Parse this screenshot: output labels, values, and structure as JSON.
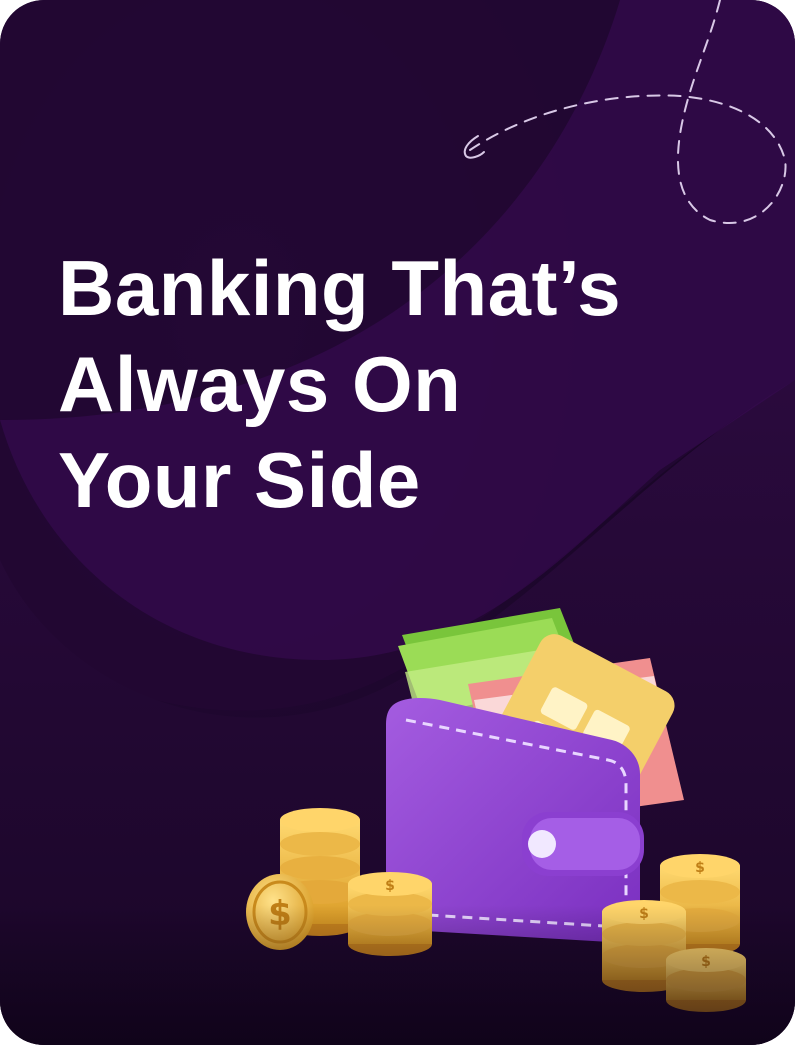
{
  "hero": {
    "headline_lines": [
      "Banking That’s",
      "Always On",
      "Your Side"
    ]
  },
  "colors": {
    "background_dark": "#14051f",
    "background_purple": "#3a0a55",
    "headline_text": "#ffffff",
    "wallet_purple": "#8b3fd0",
    "coin_gold": "#f2c14e",
    "bill_green": "#8fd14f",
    "card_yellow": "#f4cf6a",
    "card_pink": "#f08a8a"
  },
  "illustration": {
    "name": "wallet-with-coins-icon"
  }
}
